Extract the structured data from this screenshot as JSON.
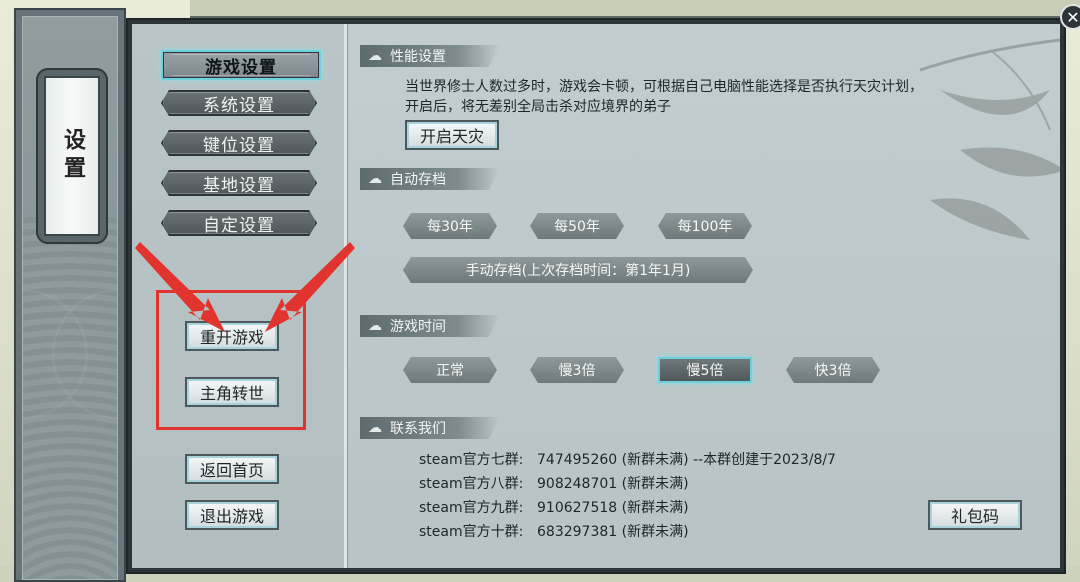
{
  "window": {
    "close_symbol": "✕"
  },
  "pillar": {
    "title": "设置"
  },
  "nav": {
    "items": [
      {
        "label": "游戏设置",
        "active": true
      },
      {
        "label": "系统设置",
        "active": false
      },
      {
        "label": "键位设置",
        "active": false
      },
      {
        "label": "基地设置",
        "active": false
      },
      {
        "label": "自定设置",
        "active": false
      }
    ],
    "restart_label": "重开游戏",
    "reincarnate_label": "主角转世",
    "return_home_label": "返回首页",
    "exit_label": "退出游戏"
  },
  "performance": {
    "title": "性能设置",
    "line1": "当世界修士人数过多时，游戏会卡顿，可根据自己电脑性能选择是否执行天灾计划，",
    "line2": "开启后，将无差别全局击杀对应境界的弟子",
    "button_label": "开启天灾"
  },
  "autosave": {
    "title": "自动存档",
    "options": [
      "每30年",
      "每50年",
      "每100年"
    ],
    "manual_label": "手动存档(上次存档时间：第1年1月)"
  },
  "game_time": {
    "title": "游戏时间",
    "options": [
      "正常",
      "慢3倍",
      "慢5倍",
      "快3倍"
    ],
    "selected": "慢5倍"
  },
  "contact": {
    "title": "联系我们",
    "groups": [
      {
        "name": "steam官方七群:",
        "info": "747495260 (新群未满) --本群创建于2023/8/7"
      },
      {
        "name": "steam官方八群:",
        "info": "908248701 (新群未满)"
      },
      {
        "name": "steam官方九群:",
        "info": "910627518 (新群未满)"
      },
      {
        "name": "steam官方十群:",
        "info": "683297381 (新群未满)"
      }
    ],
    "gift_code_label": "礼包码"
  },
  "colors": {
    "highlight": "#e2342e",
    "accent": "#6ed0db"
  },
  "icons": {
    "section": "cloud-icon",
    "close": "close-icon"
  }
}
